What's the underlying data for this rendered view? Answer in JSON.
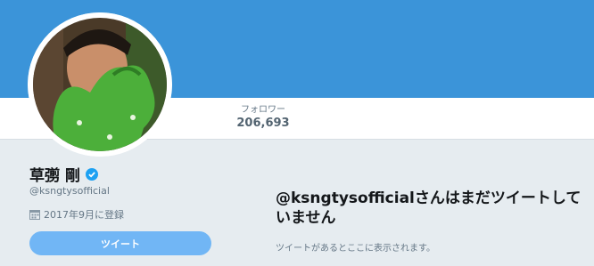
{
  "colors": {
    "banner": "#3b94d9",
    "accent": "#71b6f5",
    "verified": "#1da1f2"
  },
  "profile": {
    "display_name": "草彅 剛",
    "handle": "@ksngtysofficial",
    "joined": "2017年9月に登録",
    "verified": true,
    "avatar_icon": "profile-photo"
  },
  "nav": {
    "followers_label": "フォロワー",
    "followers_count": "206,693"
  },
  "actions": {
    "tweet_button": "ツイート"
  },
  "timeline": {
    "empty_title": "@ksngtysofficialさんはまだツイートしていません",
    "empty_subtitle": "ツイートがあるとここに表示されます。"
  }
}
